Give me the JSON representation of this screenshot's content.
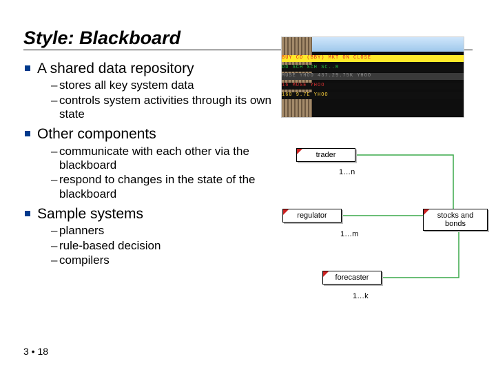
{
  "title": "Style: Blackboard",
  "bullets": [
    {
      "head": "A shared data repository",
      "sub": [
        "stores all key system data",
        "controls system activities through its own state"
      ]
    },
    {
      "head": "Other components",
      "sub": [
        "communicate with each other via the blackboard",
        "respond to changes in the state of the blackboard"
      ]
    },
    {
      "head": "Sample systems",
      "sub": [
        "planners",
        "rule-based decision",
        "compilers"
      ]
    }
  ],
  "diagram": {
    "nodes": {
      "trader": "trader",
      "regulator": "regulator",
      "forecaster": "forecaster",
      "stocks": "stocks and bonds"
    },
    "edge_labels": {
      "l1": "1…n",
      "l2": "1…m",
      "l3": "1…k"
    }
  },
  "photo_tickers": {
    "t1": "BUY CD (BBY) MKT ON CLOSE",
    "t2": "DD  SCH  SCH  SC..R",
    "t25": "MUSE  YHOO  437.29.75K  YHOO",
    "t3": "16   MUSE   YHOO",
    "t4": "160  9.7E   YHOO"
  },
  "footer": "3 • 18"
}
